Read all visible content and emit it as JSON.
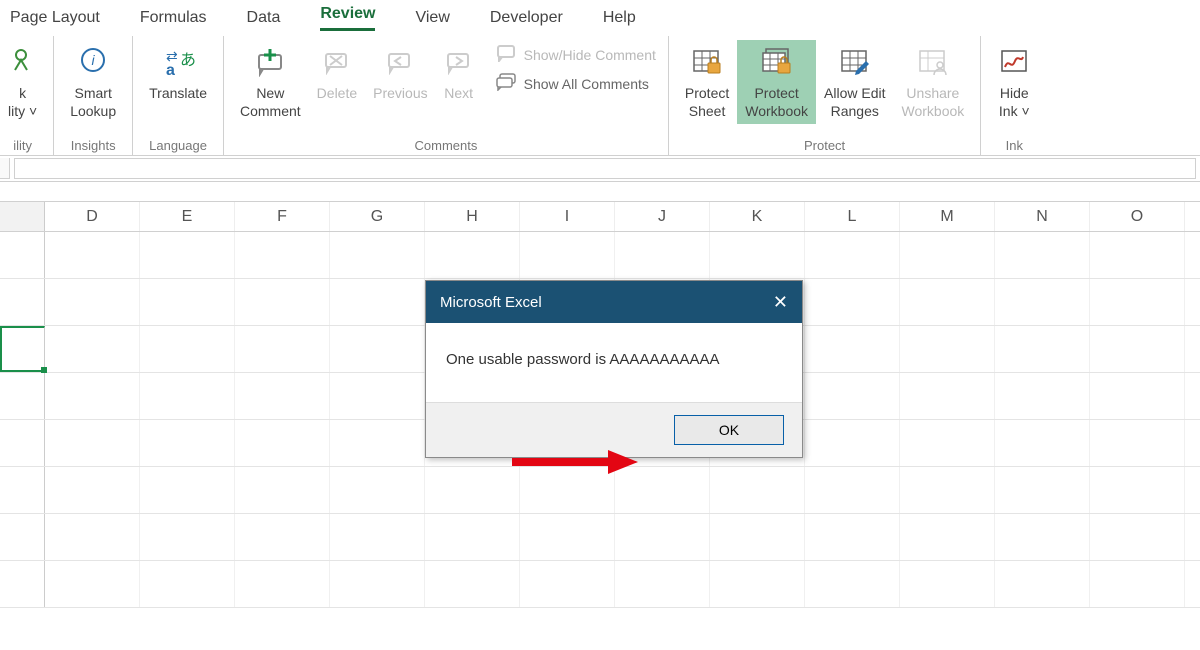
{
  "tabs": {
    "page_layout": "Page Layout",
    "formulas": "Formulas",
    "data": "Data",
    "review": "Review",
    "view": "View",
    "developer": "Developer",
    "help": "Help"
  },
  "ribbon": {
    "accessibility": {
      "line1": "k",
      "line2": "lity",
      "group": "ility"
    },
    "smart_lookup": {
      "line1": "Smart",
      "line2": "Lookup",
      "group": "Insights"
    },
    "translate": {
      "label": "Translate",
      "group": "Language"
    },
    "comments": {
      "new": {
        "line1": "New",
        "line2": "Comment"
      },
      "delete": "Delete",
      "previous": "Previous",
      "next": "Next",
      "show_hide": "Show/Hide Comment",
      "show_all": "Show All Comments",
      "group": "Comments"
    },
    "protect": {
      "sheet": {
        "line1": "Protect",
        "line2": "Sheet"
      },
      "workbook": {
        "line1": "Protect",
        "line2": "Workbook"
      },
      "allow": {
        "line1": "Allow Edit",
        "line2": "Ranges"
      },
      "unshare": {
        "line1": "Unshare",
        "line2": "Workbook"
      },
      "group": "Protect"
    },
    "ink": {
      "line1": "Hide",
      "line2": "Ink",
      "group": "Ink"
    }
  },
  "columns": [
    "",
    "D",
    "E",
    "F",
    "G",
    "H",
    "I",
    "J",
    "K",
    "L",
    "M",
    "N",
    "O"
  ],
  "dialog": {
    "title": "Microsoft Excel",
    "message": "One usable password is AAAAAAAAAAA",
    "ok": "OK"
  }
}
